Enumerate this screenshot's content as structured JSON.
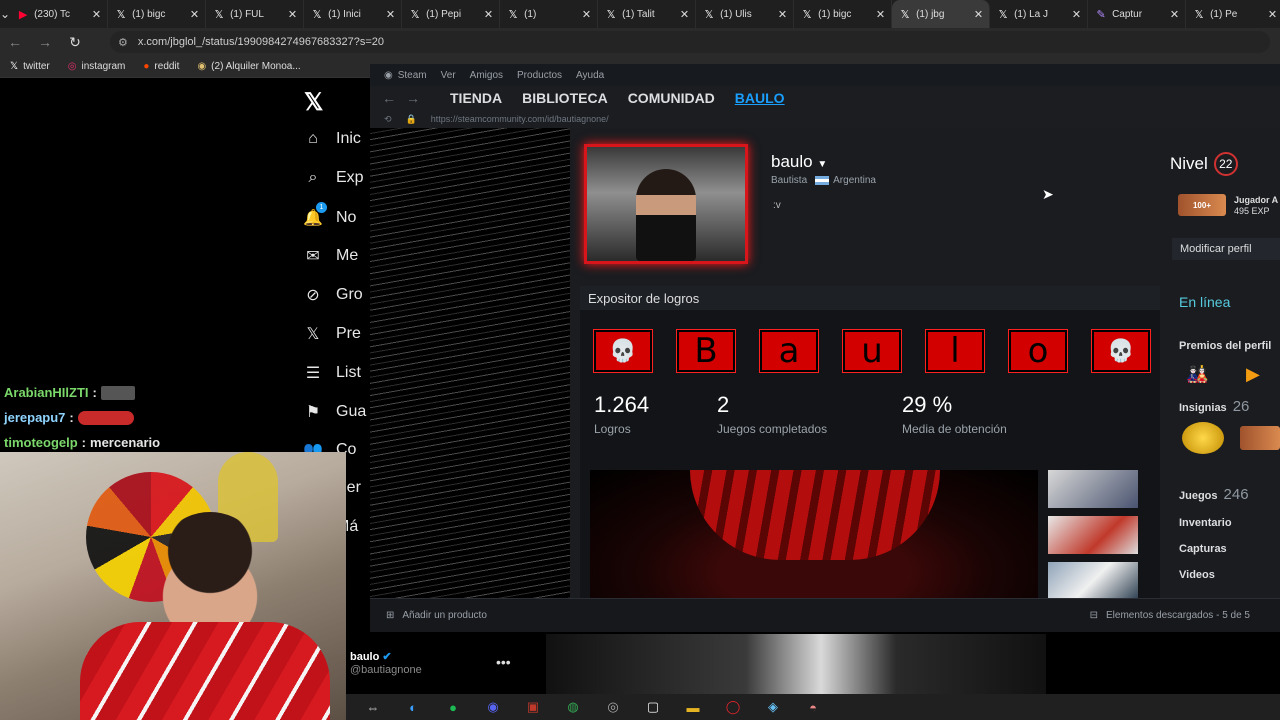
{
  "browser": {
    "tabs": [
      {
        "icon": "▶",
        "title": "(230) Tc",
        "color": "#ff0033"
      },
      {
        "icon": "𝕏",
        "title": "(1) bigc",
        "color": "#ffffff"
      },
      {
        "icon": "𝕏",
        "title": "(1) FUL",
        "color": "#ffffff"
      },
      {
        "icon": "𝕏",
        "title": "(1) Inici",
        "color": "#ffffff"
      },
      {
        "icon": "𝕏",
        "title": "(1) Pepi",
        "color": "#ffffff"
      },
      {
        "icon": "𝕏",
        "title": "(1) ",
        "color": "#ffffff"
      },
      {
        "icon": "𝕏",
        "title": "(1) Talit",
        "color": "#ffffff"
      },
      {
        "icon": "𝕏",
        "title": "(1) Ulis",
        "color": "#ffffff"
      },
      {
        "icon": "𝕏",
        "title": "(1) bigc",
        "color": "#ffffff"
      },
      {
        "icon": "𝕏",
        "title": "(1) jbg",
        "color": "#ffffff",
        "active": true
      },
      {
        "icon": "𝕏",
        "title": "(1) La J",
        "color": "#ffffff"
      },
      {
        "icon": "✎",
        "title": "Captur",
        "color": "#b48cff"
      },
      {
        "icon": "𝕏",
        "title": "(1) Pe",
        "color": "#ffffff"
      }
    ],
    "url": "x.com/jbglol_/status/1990984274967683327?s=20",
    "bookmarks": [
      {
        "icon": "𝕏",
        "label": "twitter",
        "color": "#fff"
      },
      {
        "icon": "◎",
        "label": "instagram",
        "color": "#e1306c"
      },
      {
        "icon": "●",
        "label": "reddit",
        "color": "#ff4500"
      },
      {
        "icon": "◉",
        "label": "(2) Alquiler Monoa...",
        "color": "#e0c070"
      }
    ]
  },
  "x_sidebar": {
    "items": [
      {
        "icon": "⌂",
        "label": "Inic"
      },
      {
        "icon": "⌕",
        "label": "Exp"
      },
      {
        "icon": "🔔",
        "label": "No"
      },
      {
        "icon": "✉",
        "label": "Me"
      },
      {
        "icon": "⊘",
        "label": "Gro"
      },
      {
        "icon": "𝕏",
        "label": "Pre"
      },
      {
        "icon": "☰",
        "label": "List"
      },
      {
        "icon": "⚑",
        "label": "Gua"
      },
      {
        "icon": "👥",
        "label": "Co"
      },
      {
        "icon": "",
        "label": "Per"
      },
      {
        "icon": "",
        "label": "Má"
      }
    ],
    "notification_count": "1"
  },
  "chat": [
    {
      "user": "ArabianHIlZTI",
      "color": "#7bd86a",
      "text": "",
      "emote": "plain"
    },
    {
      "user": "jerepapu7",
      "color": "#8fd3ff",
      "text": "",
      "emote": "red"
    },
    {
      "user": "timoteogelp",
      "color": "#7bd86a",
      "text": "mercenario",
      "emote": ""
    }
  ],
  "steam": {
    "menu": [
      "Steam",
      "Ver",
      "Amigos",
      "Productos",
      "Ayuda"
    ],
    "nav": [
      "TIENDA",
      "BIBLIOTECA",
      "COMUNIDAD",
      "BAULO"
    ],
    "url": "https://steamcommunity.com/id/bautiagnone/",
    "profile": {
      "name": "baulo",
      "real_name": "Bautista",
      "country": "Argentina",
      "summary": ":v",
      "level_label": "Nivel",
      "level": "22",
      "badge_name": "Jugador A",
      "badge_xp": "495 EXP",
      "badge_text": "100+",
      "edit_label": "Modificar perfil"
    },
    "showcase": {
      "title": "Expositor de logros",
      "letters": [
        "💀",
        "B",
        "a",
        "u",
        "l",
        "o",
        "💀"
      ],
      "stats": [
        {
          "value": "1.264",
          "label": "Logros"
        },
        {
          "value": "2",
          "label": "Juegos completados"
        },
        {
          "value": "29 %",
          "label": "Media de obtención"
        }
      ]
    },
    "right": {
      "status": "En línea",
      "awards_label": "Premios del perfil",
      "badges_label": "Insignias",
      "badges_count": "26",
      "games_label": "Juegos",
      "games_count": "246",
      "inventory_label": "Inventario",
      "screenshots_label": "Capturas",
      "videos_label": "Videos"
    },
    "footer": {
      "add_product": "Añadir un producto",
      "downloads": "Elementos descargados - 5 de 5"
    }
  },
  "tweet": {
    "name": "baulo",
    "handle": "@bautiagnone"
  },
  "taskbar": [
    {
      "icon": "⇔",
      "color": "#ccc"
    },
    {
      "icon": "◐",
      "color": "#3aa0ff"
    },
    {
      "icon": "●",
      "color": "#1db954"
    },
    {
      "icon": "◉",
      "color": "#5865f2"
    },
    {
      "icon": "▣",
      "color": "#c0392b"
    },
    {
      "icon": "◍",
      "color": "#34a853"
    },
    {
      "icon": "◎",
      "color": "#aaa"
    },
    {
      "icon": "▢",
      "color": "#eee"
    },
    {
      "icon": "▬",
      "color": "#e6b422"
    },
    {
      "icon": "◯",
      "color": "#e3242b"
    },
    {
      "icon": "◈",
      "color": "#66c0f4"
    },
    {
      "icon": "◓",
      "color": "#e88"
    }
  ]
}
